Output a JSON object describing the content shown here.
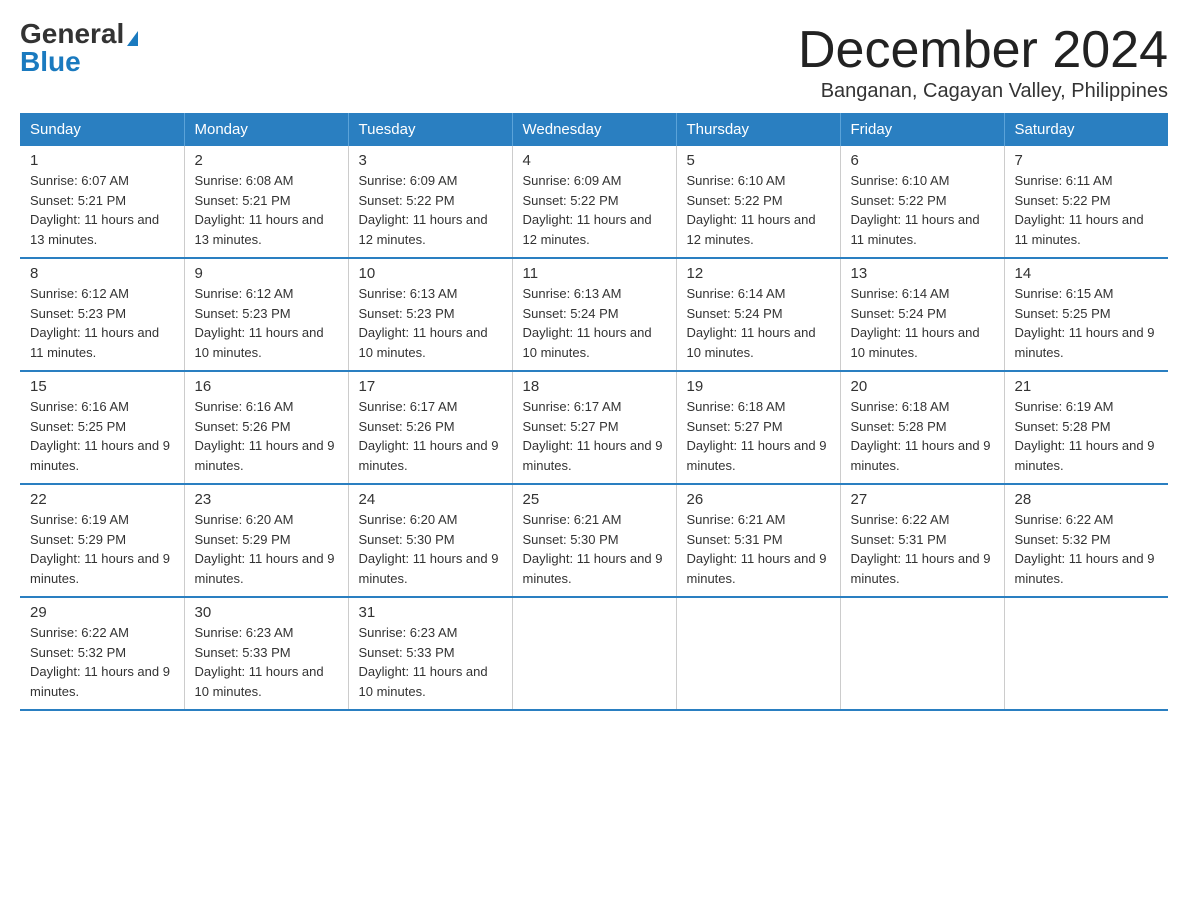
{
  "header": {
    "logo_general": "General",
    "logo_blue": "Blue",
    "month_title": "December 2024",
    "location": "Banganan, Cagayan Valley, Philippines"
  },
  "days_of_week": [
    "Sunday",
    "Monday",
    "Tuesday",
    "Wednesday",
    "Thursday",
    "Friday",
    "Saturday"
  ],
  "weeks": [
    [
      {
        "day": "1",
        "sunrise": "6:07 AM",
        "sunset": "5:21 PM",
        "daylight": "11 hours and 13 minutes."
      },
      {
        "day": "2",
        "sunrise": "6:08 AM",
        "sunset": "5:21 PM",
        "daylight": "11 hours and 13 minutes."
      },
      {
        "day": "3",
        "sunrise": "6:09 AM",
        "sunset": "5:22 PM",
        "daylight": "11 hours and 12 minutes."
      },
      {
        "day": "4",
        "sunrise": "6:09 AM",
        "sunset": "5:22 PM",
        "daylight": "11 hours and 12 minutes."
      },
      {
        "day": "5",
        "sunrise": "6:10 AM",
        "sunset": "5:22 PM",
        "daylight": "11 hours and 12 minutes."
      },
      {
        "day": "6",
        "sunrise": "6:10 AM",
        "sunset": "5:22 PM",
        "daylight": "11 hours and 11 minutes."
      },
      {
        "day": "7",
        "sunrise": "6:11 AM",
        "sunset": "5:22 PM",
        "daylight": "11 hours and 11 minutes."
      }
    ],
    [
      {
        "day": "8",
        "sunrise": "6:12 AM",
        "sunset": "5:23 PM",
        "daylight": "11 hours and 11 minutes."
      },
      {
        "day": "9",
        "sunrise": "6:12 AM",
        "sunset": "5:23 PM",
        "daylight": "11 hours and 10 minutes."
      },
      {
        "day": "10",
        "sunrise": "6:13 AM",
        "sunset": "5:23 PM",
        "daylight": "11 hours and 10 minutes."
      },
      {
        "day": "11",
        "sunrise": "6:13 AM",
        "sunset": "5:24 PM",
        "daylight": "11 hours and 10 minutes."
      },
      {
        "day": "12",
        "sunrise": "6:14 AM",
        "sunset": "5:24 PM",
        "daylight": "11 hours and 10 minutes."
      },
      {
        "day": "13",
        "sunrise": "6:14 AM",
        "sunset": "5:24 PM",
        "daylight": "11 hours and 10 minutes."
      },
      {
        "day": "14",
        "sunrise": "6:15 AM",
        "sunset": "5:25 PM",
        "daylight": "11 hours and 9 minutes."
      }
    ],
    [
      {
        "day": "15",
        "sunrise": "6:16 AM",
        "sunset": "5:25 PM",
        "daylight": "11 hours and 9 minutes."
      },
      {
        "day": "16",
        "sunrise": "6:16 AM",
        "sunset": "5:26 PM",
        "daylight": "11 hours and 9 minutes."
      },
      {
        "day": "17",
        "sunrise": "6:17 AM",
        "sunset": "5:26 PM",
        "daylight": "11 hours and 9 minutes."
      },
      {
        "day": "18",
        "sunrise": "6:17 AM",
        "sunset": "5:27 PM",
        "daylight": "11 hours and 9 minutes."
      },
      {
        "day": "19",
        "sunrise": "6:18 AM",
        "sunset": "5:27 PM",
        "daylight": "11 hours and 9 minutes."
      },
      {
        "day": "20",
        "sunrise": "6:18 AM",
        "sunset": "5:28 PM",
        "daylight": "11 hours and 9 minutes."
      },
      {
        "day": "21",
        "sunrise": "6:19 AM",
        "sunset": "5:28 PM",
        "daylight": "11 hours and 9 minutes."
      }
    ],
    [
      {
        "day": "22",
        "sunrise": "6:19 AM",
        "sunset": "5:29 PM",
        "daylight": "11 hours and 9 minutes."
      },
      {
        "day": "23",
        "sunrise": "6:20 AM",
        "sunset": "5:29 PM",
        "daylight": "11 hours and 9 minutes."
      },
      {
        "day": "24",
        "sunrise": "6:20 AM",
        "sunset": "5:30 PM",
        "daylight": "11 hours and 9 minutes."
      },
      {
        "day": "25",
        "sunrise": "6:21 AM",
        "sunset": "5:30 PM",
        "daylight": "11 hours and 9 minutes."
      },
      {
        "day": "26",
        "sunrise": "6:21 AM",
        "sunset": "5:31 PM",
        "daylight": "11 hours and 9 minutes."
      },
      {
        "day": "27",
        "sunrise": "6:22 AM",
        "sunset": "5:31 PM",
        "daylight": "11 hours and 9 minutes."
      },
      {
        "day": "28",
        "sunrise": "6:22 AM",
        "sunset": "5:32 PM",
        "daylight": "11 hours and 9 minutes."
      }
    ],
    [
      {
        "day": "29",
        "sunrise": "6:22 AM",
        "sunset": "5:32 PM",
        "daylight": "11 hours and 9 minutes."
      },
      {
        "day": "30",
        "sunrise": "6:23 AM",
        "sunset": "5:33 PM",
        "daylight": "11 hours and 10 minutes."
      },
      {
        "day": "31",
        "sunrise": "6:23 AM",
        "sunset": "5:33 PM",
        "daylight": "11 hours and 10 minutes."
      },
      {
        "day": "",
        "sunrise": "",
        "sunset": "",
        "daylight": ""
      },
      {
        "day": "",
        "sunrise": "",
        "sunset": "",
        "daylight": ""
      },
      {
        "day": "",
        "sunrise": "",
        "sunset": "",
        "daylight": ""
      },
      {
        "day": "",
        "sunrise": "",
        "sunset": "",
        "daylight": ""
      }
    ]
  ]
}
